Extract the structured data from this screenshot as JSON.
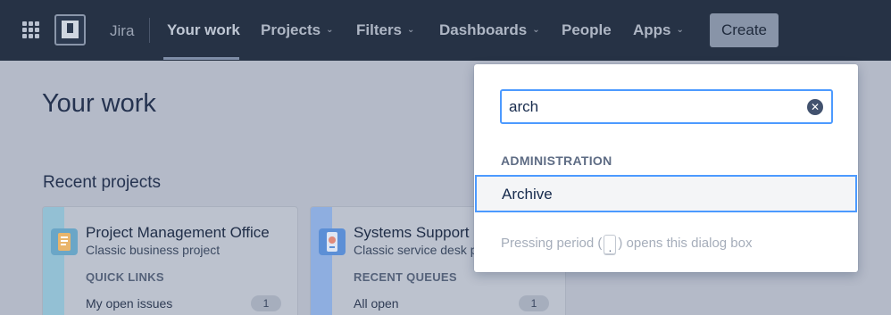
{
  "nav": {
    "brand": "Jira",
    "items": [
      {
        "label": "Your work",
        "dropdown": false
      },
      {
        "label": "Projects",
        "dropdown": true
      },
      {
        "label": "Filters",
        "dropdown": true
      },
      {
        "label": "Dashboards",
        "dropdown": true
      },
      {
        "label": "People",
        "dropdown": false
      },
      {
        "label": "Apps",
        "dropdown": true
      }
    ],
    "create_label": "Create",
    "chevron": "⌄"
  },
  "page": {
    "title": "Your work",
    "recent_projects_heading": "Recent projects",
    "projects": [
      {
        "name": "Project Management Office",
        "type": "Classic business project",
        "section_label": "QUICK LINKS",
        "link_label": "My open issues",
        "count": "1",
        "accent": "#7fb8d2",
        "icon": "notebook-icon"
      },
      {
        "name": "Systems Support",
        "type": "Classic service desk proj",
        "section_label": "RECENT QUEUES",
        "link_label": "All open",
        "count": "1",
        "accent": "#7ea2d6",
        "icon": "phone-support-icon"
      }
    ]
  },
  "search": {
    "query": "arch",
    "clear_icon": "✕",
    "group_heading": "ADMINISTRATION",
    "results": [
      {
        "label": "Archive",
        "selected": true
      }
    ],
    "hint_before": "Pressing period (",
    "hint_key": ".",
    "hint_after": ") opens this dialog box"
  },
  "colors": {
    "nav_bg": "#263245",
    "focus_border": "#4c9aff",
    "overlay_bg": "#b4bac8"
  }
}
